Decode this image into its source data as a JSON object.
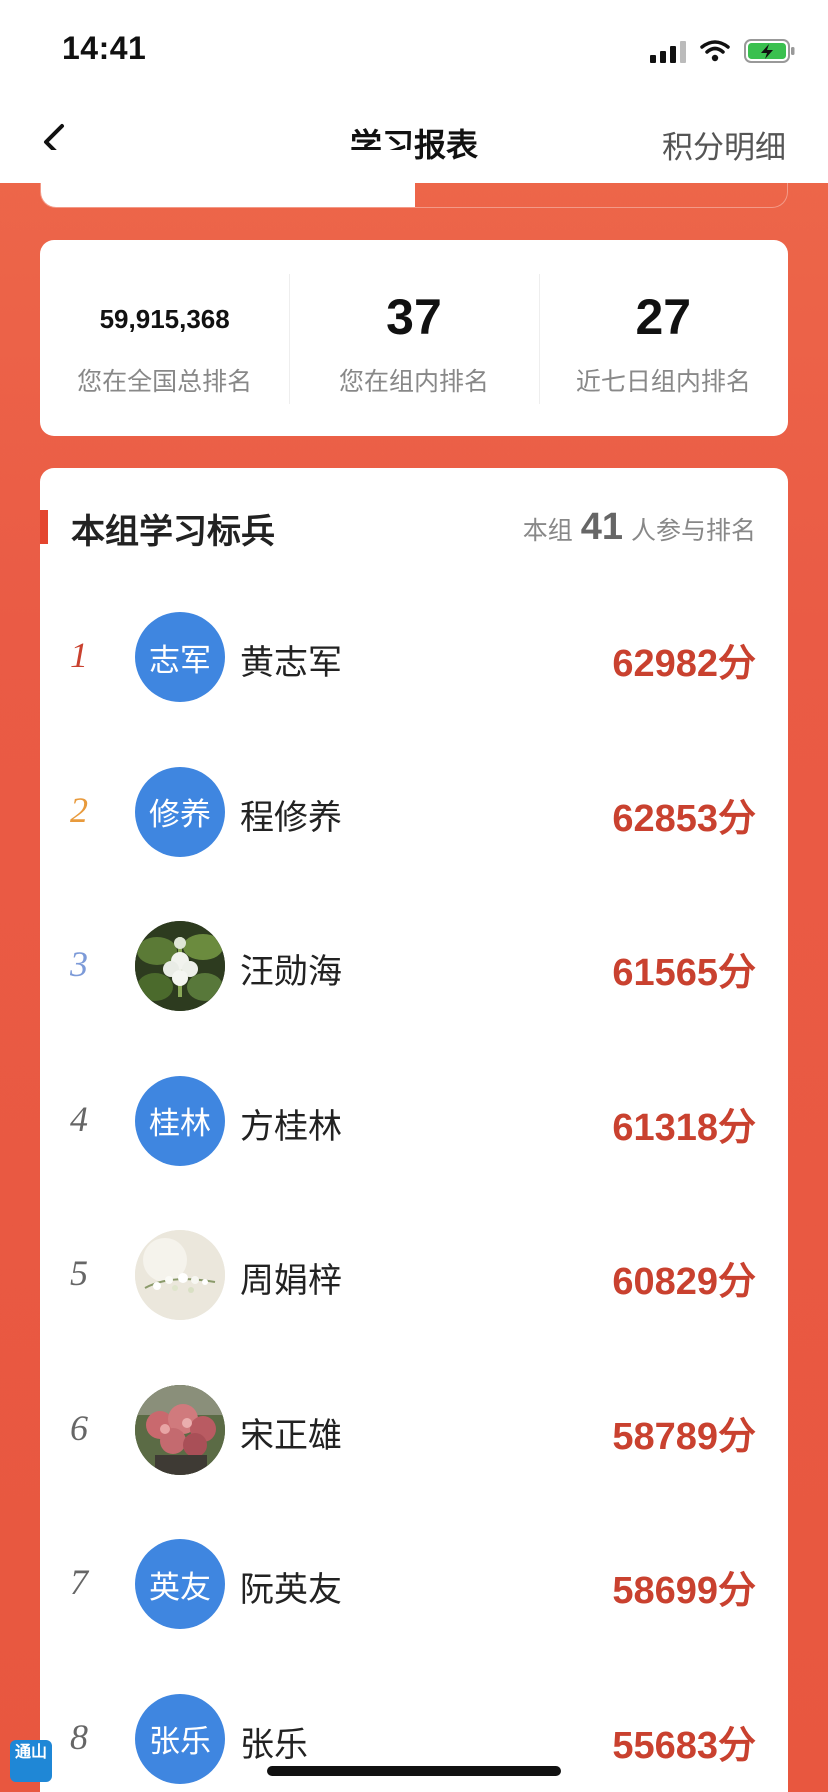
{
  "status_bar": {
    "time": "14:41"
  },
  "nav": {
    "title": "学习报表",
    "right_link": "积分明细"
  },
  "stats": [
    {
      "value": "59,915,368",
      "label": "您在全国总排名"
    },
    {
      "value": "37",
      "label": "您在组内排名"
    },
    {
      "value": "27",
      "label": "近七日组内排名"
    }
  ],
  "ranking": {
    "title": "本组学习标兵",
    "participants_prefix": "本组",
    "participants_count": "41",
    "participants_suffix": "人参与排名",
    "rows": [
      {
        "rank": "1",
        "avatar_text": "志军",
        "name": "黄志军",
        "score": "62982分",
        "rank_color": "#c9412f"
      },
      {
        "rank": "2",
        "avatar_text": "修养",
        "name": "程修养",
        "score": "62853分",
        "rank_color": "#e89a3c"
      },
      {
        "rank": "3",
        "avatar_text": "",
        "avatar_icon": "flower-photo-icon",
        "name": "汪勋海",
        "score": "61565分",
        "rank_color": "#7c9ad8"
      },
      {
        "rank": "4",
        "avatar_text": "桂林",
        "name": "方桂林",
        "score": "61318分",
        "rank_color": "#666666"
      },
      {
        "rank": "5",
        "avatar_text": "",
        "avatar_icon": "blossom-photo-icon",
        "name": "周娟梓",
        "score": "60829分",
        "rank_color": "#666666"
      },
      {
        "rank": "6",
        "avatar_text": "",
        "avatar_icon": "plant-photo-icon",
        "name": "宋正雄",
        "score": "58789分",
        "rank_color": "#666666"
      },
      {
        "rank": "7",
        "avatar_text": "英友",
        "name": "阮英友",
        "score": "58699分",
        "rank_color": "#666666"
      },
      {
        "rank": "8",
        "avatar_text": "张乐",
        "name": "张乐",
        "score": "55683分",
        "rank_color": "#666666"
      }
    ]
  },
  "corner_logo": {
    "text": "通山"
  },
  "colors": {
    "accent": "#e4452f",
    "score": "#c9412f",
    "avatar": "#3f86e0"
  }
}
